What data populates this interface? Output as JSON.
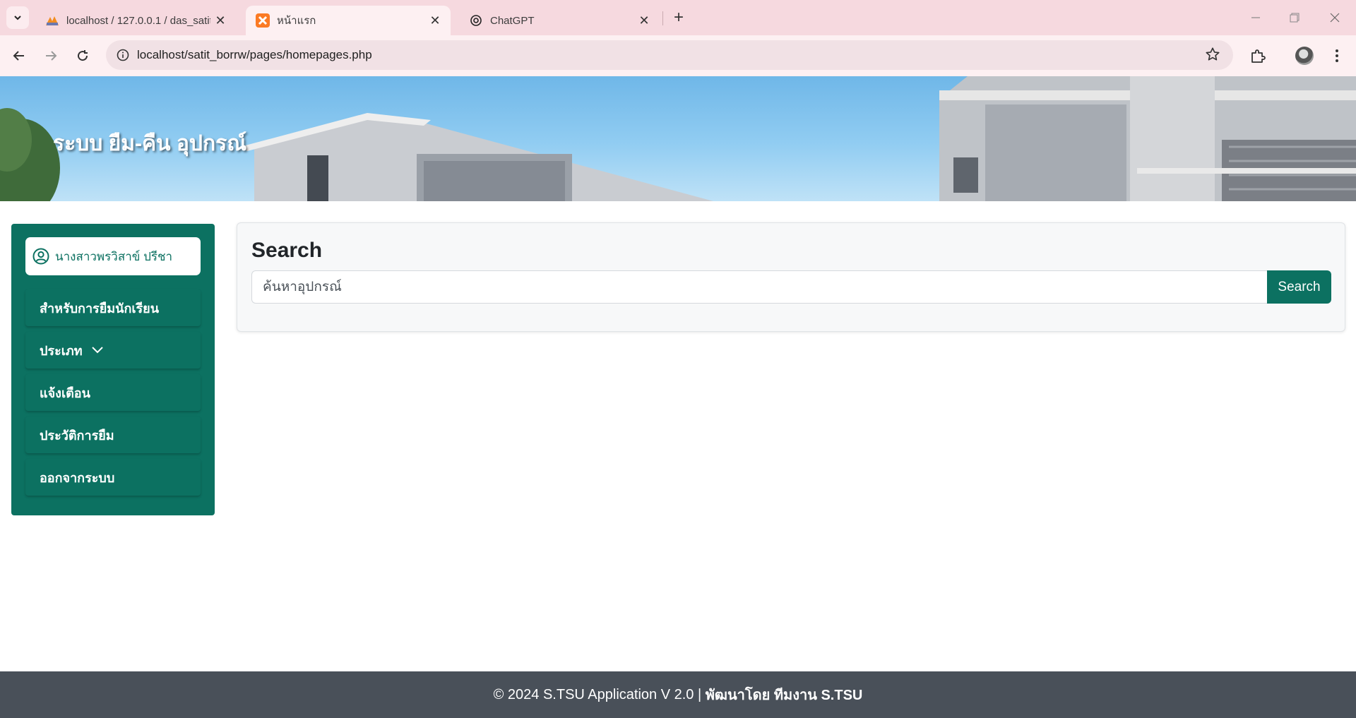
{
  "browser": {
    "tabs": [
      {
        "title": "localhost / 127.0.0.1 / das_satit_",
        "icon": "phpmyadmin-icon",
        "active": false
      },
      {
        "title": "หน้าแรก",
        "icon": "xampp-icon",
        "active": true
      },
      {
        "title": "ChatGPT",
        "icon": "openai-icon",
        "active": false
      }
    ],
    "url": "localhost/satit_borrw/pages/homepages.php"
  },
  "banner": {
    "title": "ระบบ ยืม-คืน อุปกรณ์"
  },
  "sidebar": {
    "user_name": "นางสาวพรวิสาข์ ปรีชา",
    "items": [
      {
        "label": "สำหรับการยืมนักเรียน"
      },
      {
        "label": "ประเภท",
        "has_dropdown": true
      },
      {
        "label": "แจ้งเตือน"
      },
      {
        "label": "ประวัติการยืม"
      },
      {
        "label": "ออกจากระบบ"
      }
    ]
  },
  "search": {
    "heading": "Search",
    "placeholder": "ค้นหาอุปกรณ์",
    "value": "",
    "button_label": "Search"
  },
  "footer": {
    "text": "© 2024 S.TSU Application V 2.0 | ",
    "team": "พัฒนาโดย ทีมงาน S.TSU"
  },
  "colors": {
    "primary": "#0c7161",
    "footer_bg": "#495059",
    "chrome_bg": "#f6d9df"
  }
}
